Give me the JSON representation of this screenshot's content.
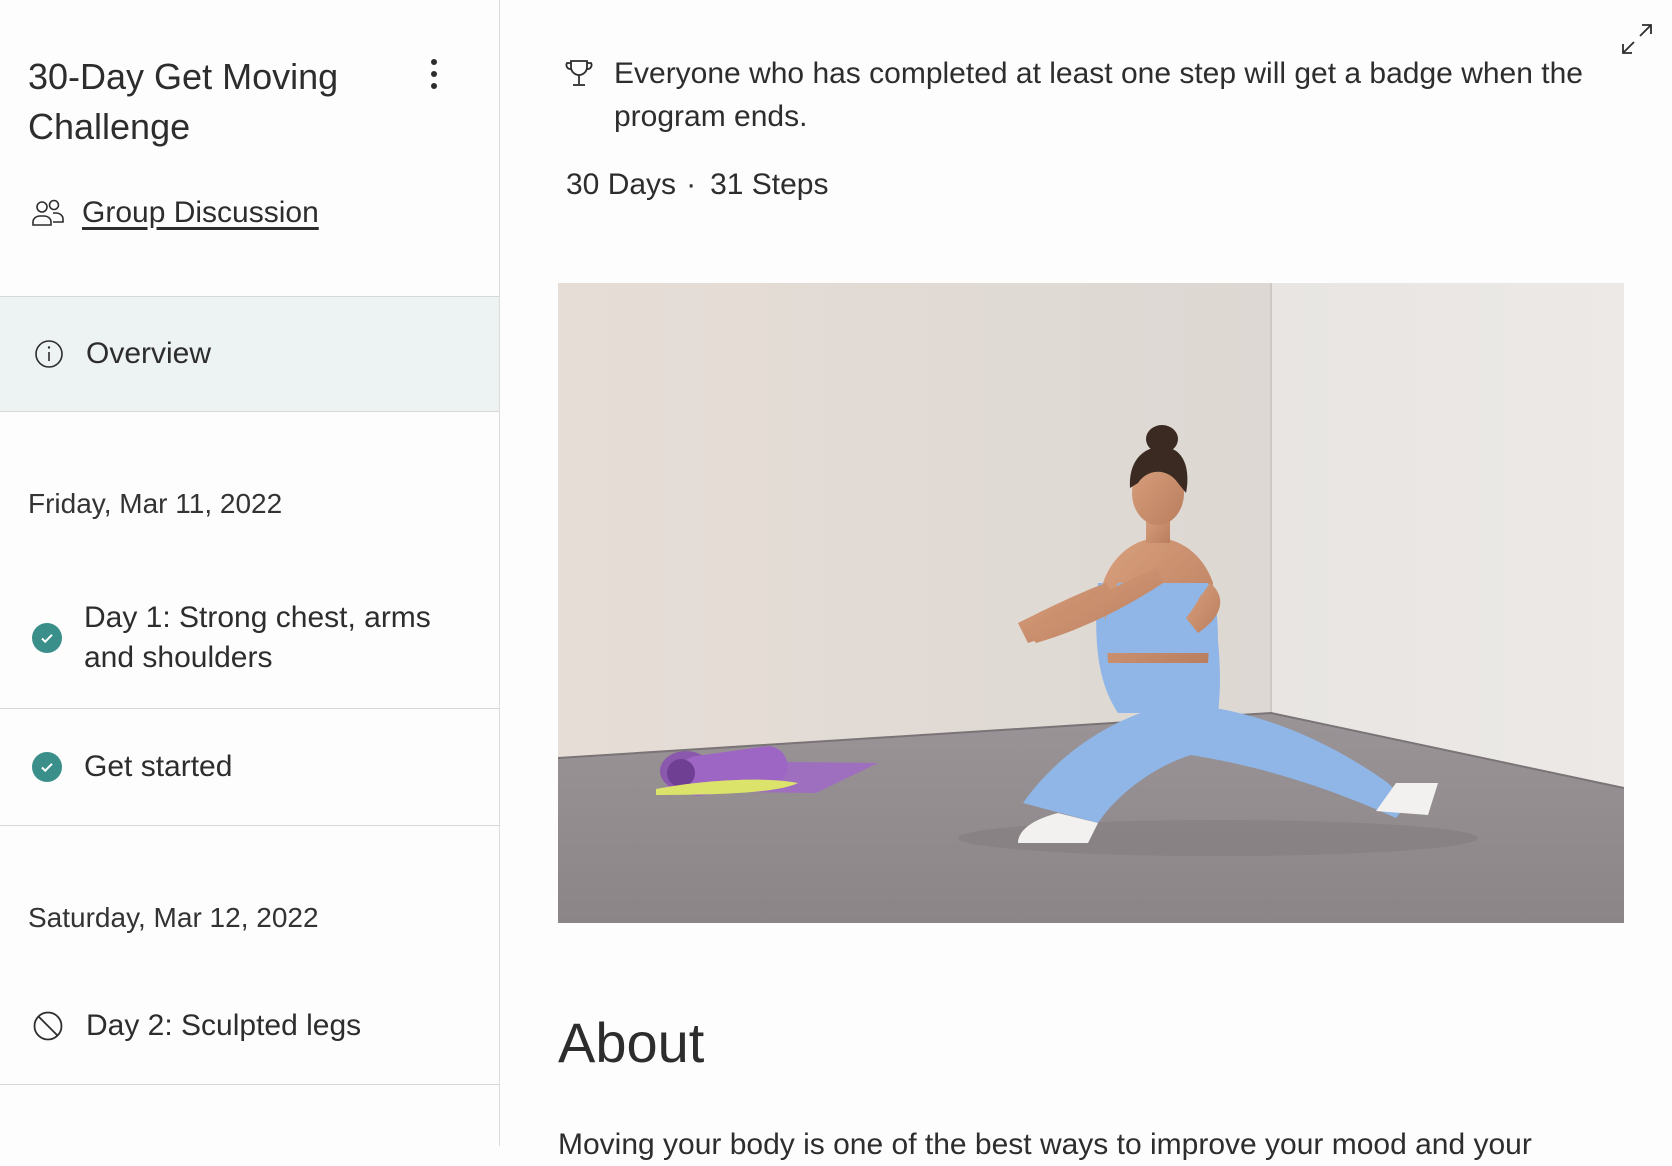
{
  "sidebar": {
    "program_title": "30-Day Get Moving Challenge",
    "group_discussion_label": "Group Discussion",
    "overview_label": "Overview",
    "sections": [
      {
        "date": "Friday, Mar 11, 2022",
        "steps": [
          {
            "label": "Day 1: Strong chest, arms and shoulders",
            "status": "completed"
          },
          {
            "label": "Get started",
            "status": "completed"
          }
        ]
      },
      {
        "date": "Saturday, Mar 12, 2022",
        "steps": [
          {
            "label": "Day 2: Sculpted legs",
            "status": "unavailable"
          }
        ]
      }
    ]
  },
  "main": {
    "badge_note": "Everyone who has completed at least one step will get a badge when the program ends.",
    "meta": {
      "days": "30 Days",
      "separator": "·",
      "steps": "31 Steps"
    },
    "about_heading": "About",
    "about_text": "Moving your body is one of the best ways to improve your mood and your"
  },
  "icons": {
    "more": "more-vertical-icon",
    "group": "group-icon",
    "overview": "info-icon",
    "completed": "check-circle-icon",
    "unavailable": "blocked-icon",
    "trophy": "trophy-icon",
    "expand": "expand-icon"
  },
  "colors": {
    "accent": "#3b8f8a",
    "selected_bg": "#edf3f2",
    "text": "#2d2d2d"
  }
}
